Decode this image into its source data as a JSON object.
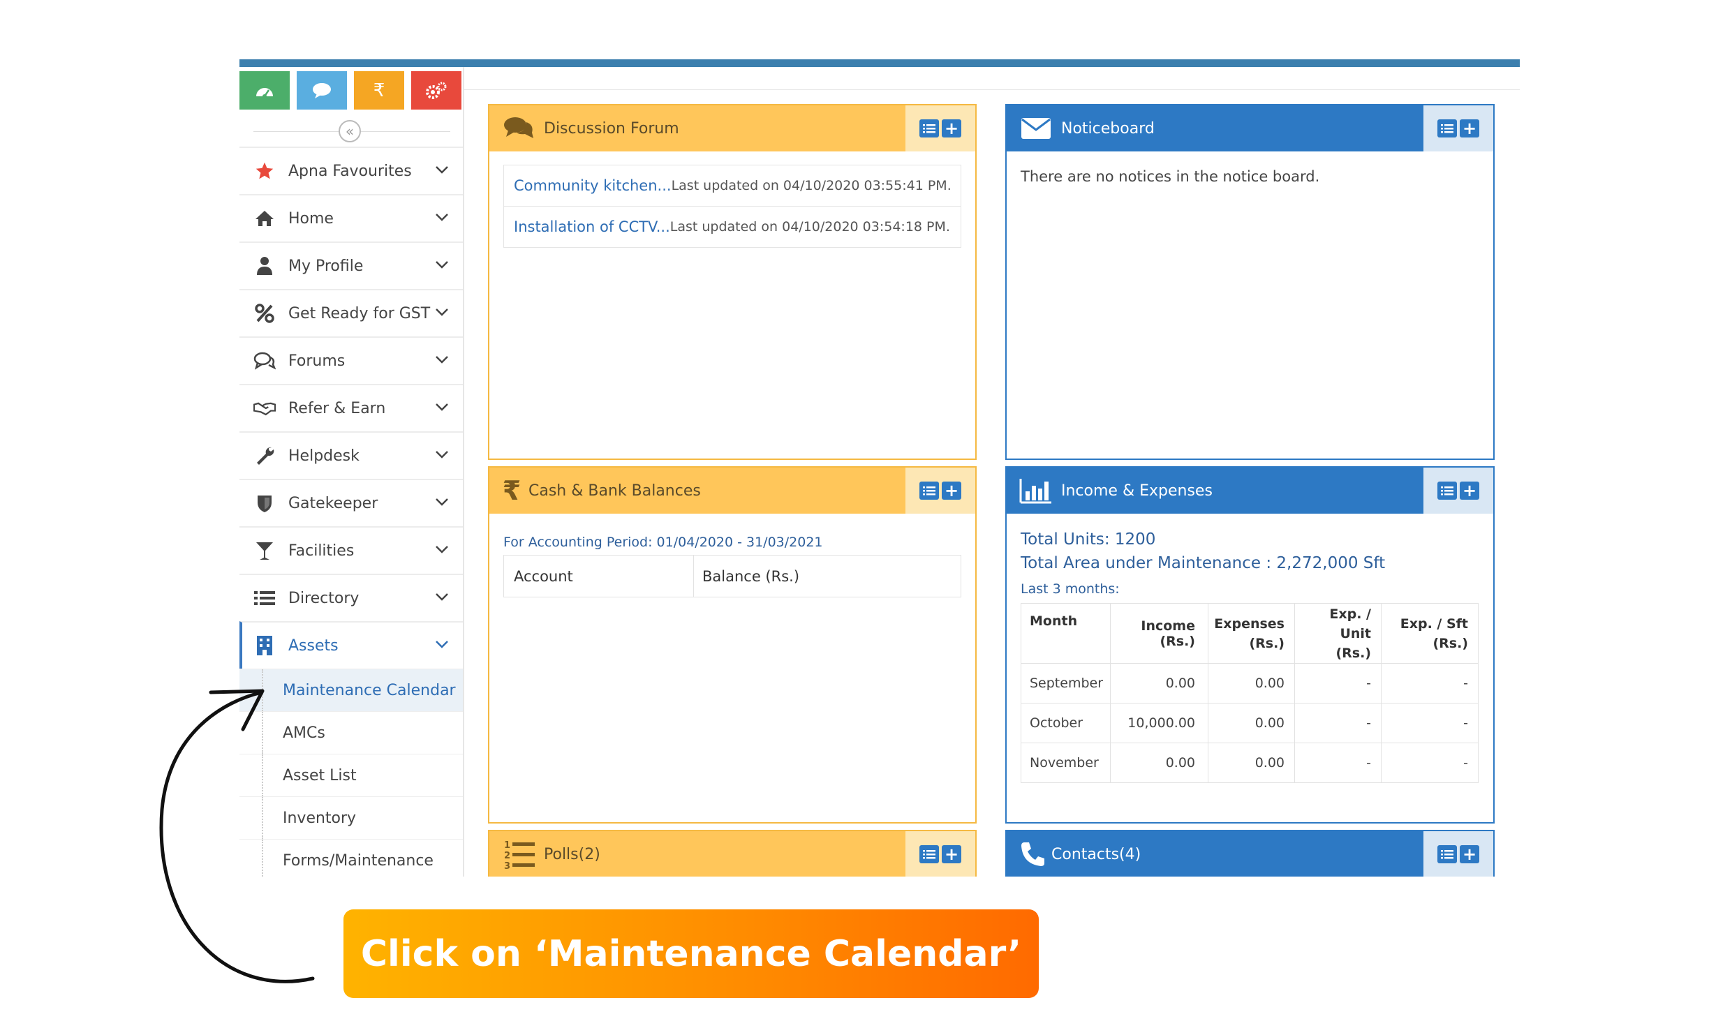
{
  "quick_actions": [
    {
      "name": "dashboard",
      "icon": "dashboard-icon",
      "color": "#4cae6a"
    },
    {
      "name": "chat",
      "icon": "chat-icon",
      "color": "#5aaee0"
    },
    {
      "name": "rupee",
      "icon": "rupee-icon",
      "glyph": "₹",
      "color": "#f5a623"
    },
    {
      "name": "settings",
      "icon": "gears-icon",
      "color": "#e8493c"
    }
  ],
  "sidebar": {
    "collapse_glyph": "«",
    "items": [
      {
        "label": "Apna Favourites",
        "icon": "star-icon"
      },
      {
        "label": "Home",
        "icon": "home-icon"
      },
      {
        "label": "My Profile",
        "icon": "user-icon"
      },
      {
        "label": "Get Ready for GST",
        "icon": "percent-icon"
      },
      {
        "label": "Forums",
        "icon": "comments-icon"
      },
      {
        "label": "Refer & Earn",
        "icon": "handshake-icon"
      },
      {
        "label": "Helpdesk",
        "icon": "wrench-icon"
      },
      {
        "label": "Gatekeeper",
        "icon": "shield-icon"
      },
      {
        "label": "Facilities",
        "icon": "glass-icon"
      },
      {
        "label": "Directory",
        "icon": "list-icon"
      },
      {
        "label": "Assets",
        "icon": "building-icon"
      }
    ],
    "subitems": [
      "Maintenance Calendar",
      "AMCs",
      "Asset List",
      "Inventory",
      "Forms/Maintenance"
    ]
  },
  "discussion": {
    "title": "Discussion Forum",
    "posts": [
      {
        "link": "Community kitchen...",
        "meta": "Last updated on 04/10/2020 03:55:41 PM."
      },
      {
        "link": "Installation of CCTV...",
        "meta": "Last updated on 04/10/2020 03:54:18 PM."
      }
    ]
  },
  "noticeboard": {
    "title": "Noticeboard",
    "empty_text": "There are no notices in the notice board."
  },
  "cash": {
    "title": "Cash & Bank Balances",
    "period": "For Accounting Period: 01/04/2020 - 31/03/2021",
    "col_account": "Account",
    "col_balance": "Balance (Rs.)"
  },
  "income": {
    "title": "Income & Expenses",
    "total_units": "Total Units: 1200",
    "total_area": "Total Area under Maintenance : 2,272,000 Sft",
    "last_months": "Last 3 months:",
    "headers": {
      "month": "Month",
      "income": "Income (Rs.)",
      "exp_1": "Expenses",
      "exp_2": "(Rs.)",
      "unit_1": "Exp. / Unit",
      "unit_2": "(Rs.)",
      "sft_1": "Exp. / Sft",
      "sft_2": "(Rs.)"
    },
    "rows": [
      {
        "month": "September",
        "income": "0.00",
        "expenses": "0.00",
        "per_unit": "-",
        "per_sft": "-"
      },
      {
        "month": "October",
        "income": "10,000.00",
        "expenses": "0.00",
        "per_unit": "-",
        "per_sft": "-"
      },
      {
        "month": "November",
        "income": "0.00",
        "expenses": "0.00",
        "per_unit": "-",
        "per_sft": "-"
      }
    ]
  },
  "polls": {
    "title": "Polls(2)"
  },
  "contacts": {
    "title": "Contacts(4)"
  },
  "callout": {
    "text": "Click on ‘Maintenance Calendar’"
  },
  "colors": {
    "accent_blue": "#2d79c4",
    "accent_yellow": "#ffc65a",
    "callout_orange": "#ff8a00"
  }
}
